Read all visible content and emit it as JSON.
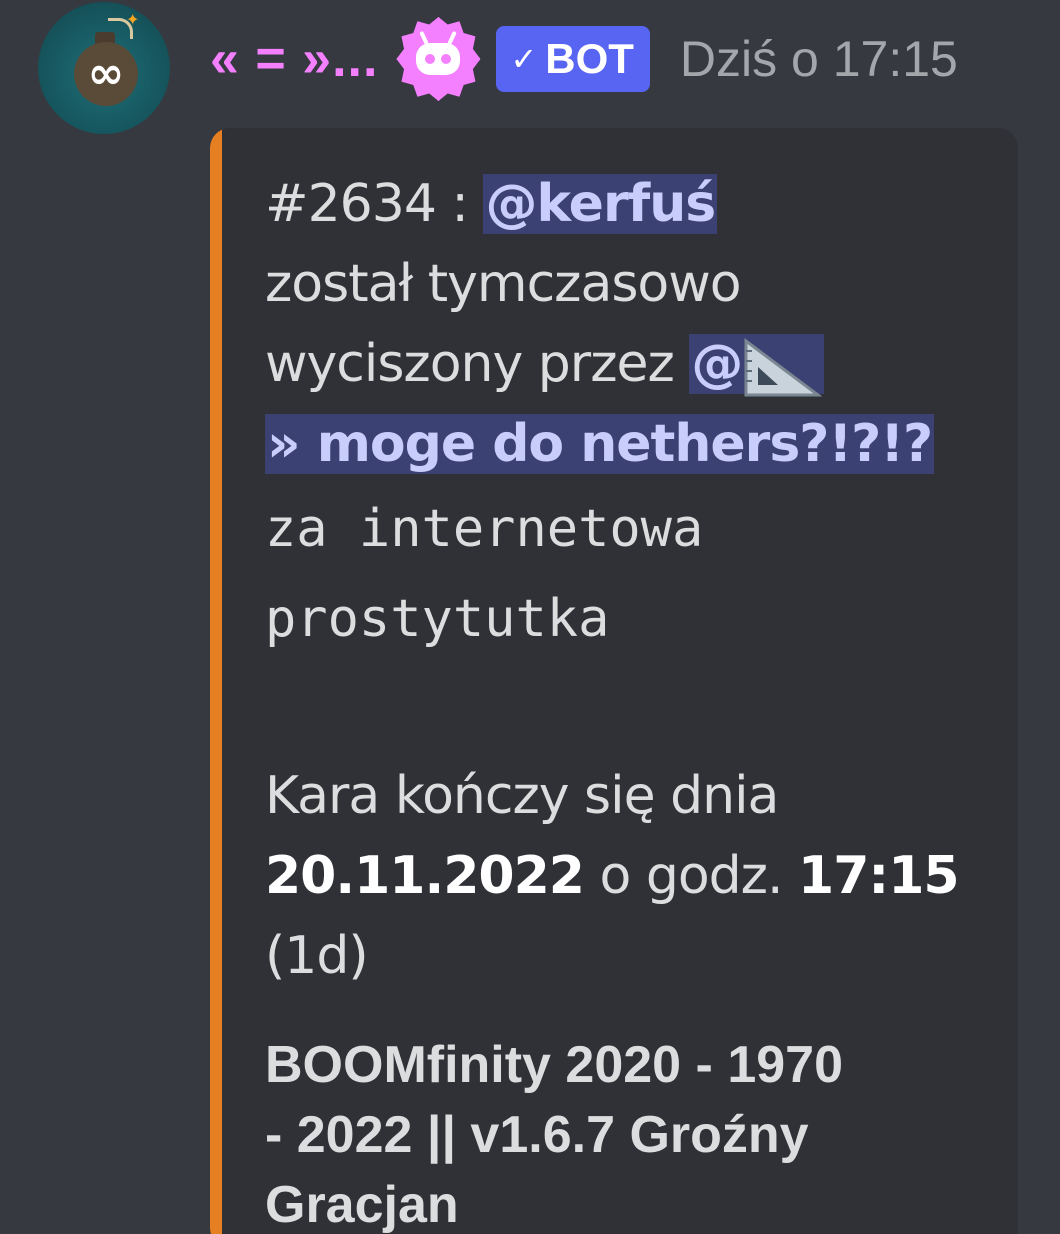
{
  "message": {
    "avatar_icon": "bomb-infinity-avatar",
    "username": "« = »...",
    "role_icon": "robot-flower-icon",
    "bot_badge_check": "✓",
    "bot_badge": "BOT",
    "timestamp": "Dziś o 17:15",
    "colors": {
      "username": "#f47fff",
      "bot_badge": "#5865f2",
      "embed_bar": "#e67e22",
      "background": "#36393f",
      "embed_background": "#2f3136"
    }
  },
  "embed": {
    "case_prefix": "#2634 : ",
    "target_mention": "@kerfuś",
    "muted_text_1": "został tymczasowo",
    "muted_text_2": "wyciszony przez ",
    "moderator_at": "@",
    "moderator_name": "» moge do nethers?!?!?",
    "reason_line_1": "za internetowa",
    "reason_line_2": "prostytutka",
    "expiry_prefix": "Kara kończy się dnia",
    "expiry_date": "20.11.2022",
    "expiry_mid": " o godz. ",
    "expiry_time": "17:15",
    "expiry_duration": "(1d)",
    "footer_line_1": "BOOMfinity 2020 - 1970",
    "footer_line_2": "- 2022 || v1.6.7 Groźny",
    "footer_line_3": "Gracjan"
  }
}
